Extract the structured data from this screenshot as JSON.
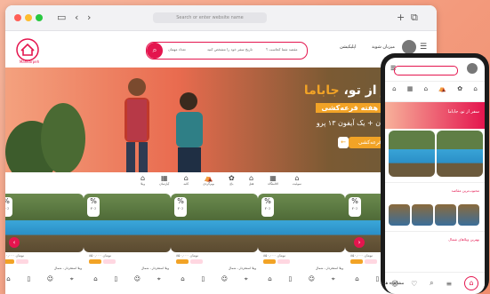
{
  "browser": {
    "url_placeholder": "Search or enter website name"
  },
  "header": {
    "logo_text": "Mahkarpeh",
    "search_location": "مقصد شما کجاست ؟",
    "search_dates": "تاریخ سفر خود را مشخص کنید",
    "search_guests": "تعداد مهمان",
    "host_link": "میزبان شوید",
    "app_link": "اپلیکیشن"
  },
  "hero": {
    "title_part1": "سفر از تو، ",
    "title_accent": "جاباما",
    "ribbon": "هفته قرعه‌کشی",
    "subtitle": "سفر رایگان + یک آیفون ۱۳ پرو",
    "cta": "قرعه‌کشی"
  },
  "categories": [
    {
      "icon": "⌂",
      "label": "ویلا"
    },
    {
      "icon": "▦",
      "label": "آپارتمان"
    },
    {
      "icon": "⌂",
      "label": "کلبه"
    },
    {
      "icon": "⛺",
      "label": "بوم‌گردی"
    },
    {
      "icon": "✿",
      "label": "باغ"
    },
    {
      "icon": "⌂",
      "label": "هتل"
    },
    {
      "icon": "▦",
      "label": "اقامتگاه"
    },
    {
      "icon": "⌂",
      "label": "سوئیت"
    }
  ],
  "cards": [
    {
      "discount": "۲۰٪",
      "price": "۸۵۰,۰۰۰ تومان",
      "location": "ویلا استخردار ، شمال"
    },
    {
      "discount": "۲۰٪",
      "price": "۸۵۰,۰۰۰ تومان",
      "location": "ویلا استخردار ، شمال"
    },
    {
      "discount": "۲۰٪",
      "price": "۸۵۰,۰۰۰ تومان",
      "location": "ویلا استخردار ، شمال"
    },
    {
      "discount": "۲۰٪",
      "price": "۸۵۰,۰۰۰ تومان",
      "location": "ویلا استخردار ، شمال"
    },
    {
      "discount": "۲۰٪",
      "price": "۸۵۰,۰۰۰ تومان",
      "location": "ویلا استخردار ، شمال"
    }
  ],
  "phone": {
    "hero_text": "سفر از تو، جاباما",
    "section_title": "محبوب‌ترین مقاصد",
    "section_title2": "بهترین ویلاهای شمال",
    "more_label": "مشاهده همه"
  },
  "colors": {
    "brand": "#e4154e",
    "accent": "#f2a326"
  }
}
